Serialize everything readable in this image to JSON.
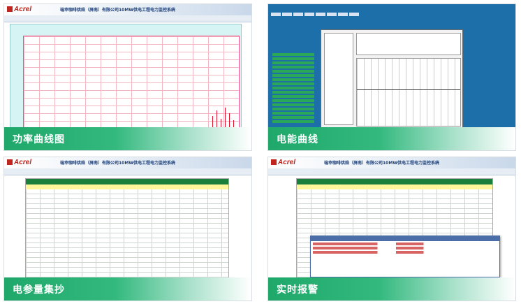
{
  "brand": "Acrel",
  "app_title": "瑞幸咖啡烘焙（屏南）有限公司10MW供电工程电力监控系统",
  "cards": [
    {
      "caption": "功率曲线图"
    },
    {
      "caption": "电能曲线"
    },
    {
      "caption": "电参量集抄"
    },
    {
      "caption": "实时报警"
    }
  ],
  "colors": {
    "caption_green": "#1fa86a",
    "logo_red": "#c0261d",
    "curve_red": "#e0102a",
    "scada_blue": "#1c6fa9"
  }
}
